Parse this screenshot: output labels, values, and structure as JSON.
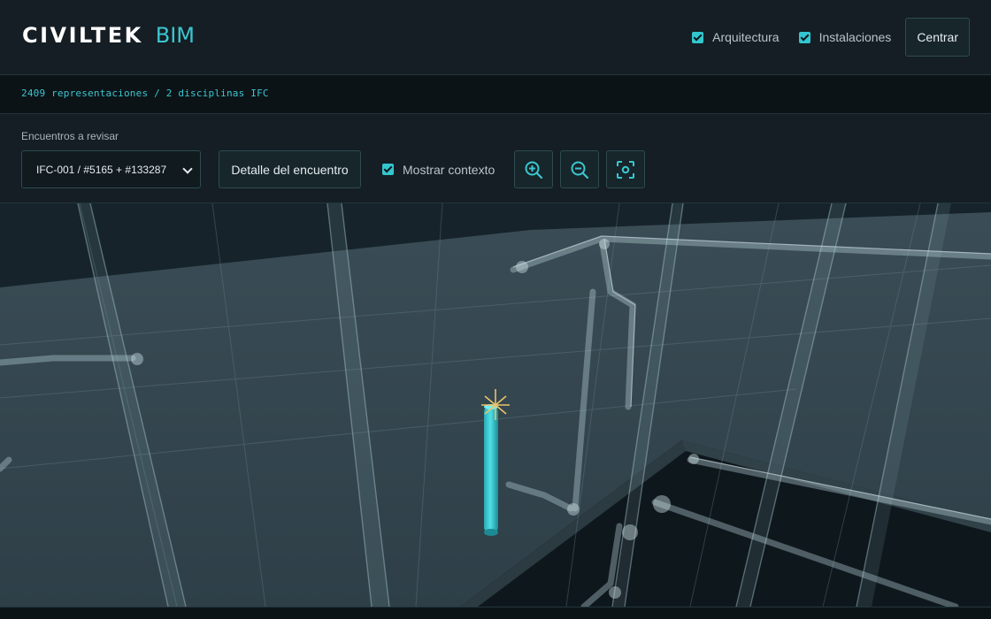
{
  "app": {
    "logo": "CIVILTEK",
    "logo_sub": "BIM"
  },
  "header": {
    "layers": [
      {
        "label": "Arquitectura",
        "checked": true
      },
      {
        "label": "Instalaciones",
        "checked": true
      }
    ],
    "center_label": "Centrar"
  },
  "stats": {
    "text": "2409 representaciones / 2 disciplinas IFC"
  },
  "panel": {
    "encounters_label": "Encuentros a revisar",
    "selected_encounter": "IFC-001 / #5165 + #133287",
    "detail_label": "Detalle del encuentro",
    "context_label": "Mostrar contexto",
    "context_checked": true
  },
  "icons": {
    "zoom_in": "zoom-in-icon",
    "zoom_out": "zoom-out-icon",
    "focus": "focus-icon"
  },
  "colors": {
    "accent": "#3cc6cf",
    "highlight_pipe": "#37c9d2",
    "clash_marker": "#e9c46a"
  }
}
